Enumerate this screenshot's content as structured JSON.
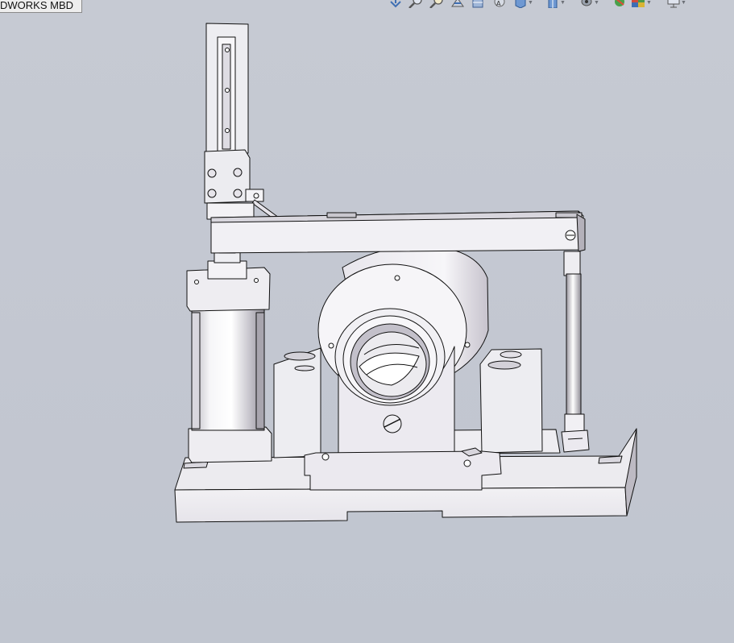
{
  "app": {
    "tab_label": "DWORKS MBD"
  },
  "toolbar": {
    "items": [
      {
        "icon": "view-orientation-icon",
        "has_dropdown": false
      },
      {
        "icon": "zoom-to-fit-icon",
        "has_dropdown": false
      },
      {
        "icon": "zoom-to-area-icon",
        "has_dropdown": false
      },
      {
        "icon": "previous-view-icon",
        "has_dropdown": false
      },
      {
        "icon": "section-view-icon",
        "has_dropdown": false
      },
      {
        "icon": "dynamic-annotation-views-icon",
        "has_dropdown": false
      },
      {
        "icon": "view-orientation-cube-icon",
        "has_dropdown": true
      },
      {
        "icon": "display-style-icon",
        "has_dropdown": true
      },
      {
        "icon": "hide-show-items-icon",
        "has_dropdown": true
      },
      {
        "icon": "edit-appearance-icon",
        "has_dropdown": false
      },
      {
        "icon": "apply-scene-icon",
        "has_dropdown": true
      },
      {
        "icon": "view-settings-icon",
        "has_dropdown": true
      }
    ]
  },
  "colors": {
    "viewport_background": "#c4c8d2",
    "model_face": "#f4f3f6",
    "model_shade": "#c9c6cf",
    "model_edge": "#111111",
    "toolbar_icon": "#3f6fb3"
  }
}
